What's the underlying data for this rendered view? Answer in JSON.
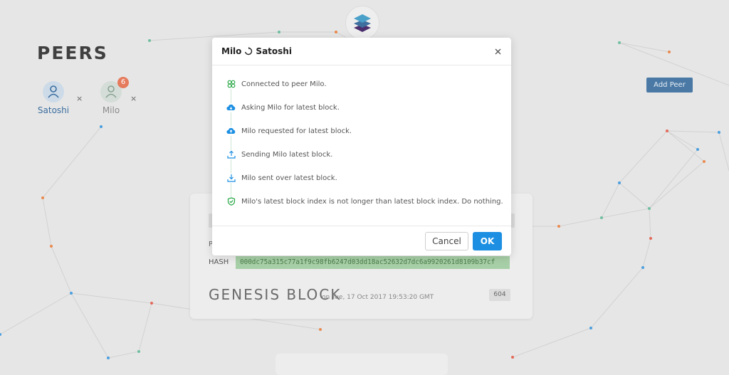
{
  "page": {
    "title": "PEERS",
    "add_peer_label": "Add Peer"
  },
  "peers": [
    {
      "name": "Satoshi",
      "remove": "×",
      "color": "#4a79a5"
    },
    {
      "name": "Milo",
      "remove": "×",
      "badge": "6",
      "color": "#7a9a8a"
    }
  ],
  "block": {
    "hash_label": "HASH",
    "hash_value": "000dc75a315c77a1f9c98fb6247d03dd18ac52632d7dc6a9920261d8109b37cf",
    "p_label": "P",
    "title": "GENESIS BLOCK",
    "date": "on Tue, 17 Oct 2017 19:53:20 GMT",
    "number": "604"
  },
  "modal": {
    "title_left": "Milo",
    "title_right": "Satoshi",
    "cancel_label": "Cancel",
    "ok_label": "OK",
    "log": [
      {
        "icon": "connected-icon",
        "text": "Connected to peer Milo."
      },
      {
        "icon": "cloud-download-icon",
        "text": "Asking Milo for latest block."
      },
      {
        "icon": "cloud-upload-icon",
        "text": "Milo requested for latest block."
      },
      {
        "icon": "upload-icon",
        "text": "Sending Milo latest block."
      },
      {
        "icon": "download-icon",
        "text": "Milo sent over latest block."
      },
      {
        "icon": "shield-check-icon",
        "text": "Milo's latest block index is not longer than latest block index. Do nothing."
      }
    ]
  },
  "colors": {
    "accent": "#1c8fe3",
    "success": "#27a745",
    "add_peer": "#4a79a5"
  }
}
